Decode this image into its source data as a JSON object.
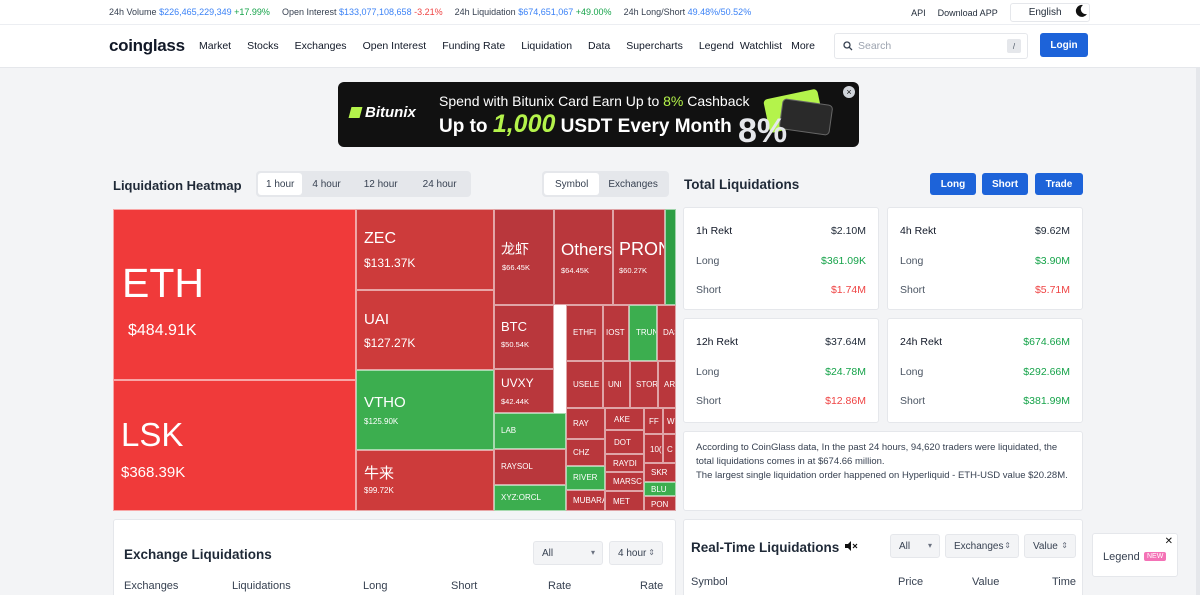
{
  "ticker": {
    "volume_label": "24h Volume",
    "volume_value": "$226,465,229,349",
    "volume_change": "+17.99%",
    "oi_label": "Open Interest",
    "oi_value": "$133,077,108,658",
    "oi_change": "-3.21%",
    "liq_label": "24h Liquidation",
    "liq_value": "$674,651,067",
    "liq_change": "+49.00%",
    "ls_label": "24h Long/Short",
    "ls_value": "49.48%/50.52%",
    "api": "API",
    "download": "Download APP",
    "language": "English"
  },
  "nav": {
    "logo": "coinglass",
    "items": [
      "Market",
      "Stocks",
      "Exchanges",
      "Open Interest",
      "Funding Rate",
      "Liquidation",
      "Data",
      "Supercharts",
      "Legend",
      "Watchlist",
      "More"
    ],
    "search_placeholder": "Search",
    "search_kbd": "/",
    "login": "Login"
  },
  "banner": {
    "brand": "Bitunix",
    "line1_pre": "Spend with Bitunix Card Earn Up to ",
    "line1_hl": "8%",
    "line1_post": " Cashback",
    "line2_pre": "Up to ",
    "line2_hl": "1,000",
    "line2_post": " USDT Every Month"
  },
  "heatmap": {
    "title": "Liquidation Heatmap",
    "time_tabs": [
      "1 hour",
      "4 hour",
      "12 hour",
      "24 hour"
    ],
    "view_tabs": [
      "Symbol",
      "Exchanges"
    ],
    "cells": {
      "eth": {
        "name": "ETH",
        "value": "$484.91K"
      },
      "lsk": {
        "name": "LSK",
        "value": "$368.39K"
      },
      "zec": {
        "name": "ZEC",
        "value": "$131.37K"
      },
      "uai": {
        "name": "UAI",
        "value": "$127.27K"
      },
      "vtho": {
        "name": "VTHO",
        "value": "$125.90K"
      },
      "niulai": {
        "name": "牛来",
        "value": "$99.72K"
      },
      "longxia": {
        "name": "龙虾",
        "value": "$66.45K"
      },
      "others": {
        "name": "Others",
        "value": "$64.45K"
      },
      "pron": {
        "name": "PRON",
        "value": "$60.27K"
      },
      "btc": {
        "name": "BTC",
        "value": "$50.54K"
      },
      "uvxy": {
        "name": "UVXY",
        "value": "$42.44K"
      },
      "lab": {
        "name": "LAB"
      },
      "raysol": {
        "name": "RAYSOL"
      },
      "xyz": {
        "name": "XYZ:ORCL"
      },
      "ethfi": {
        "name": "ETHFI"
      },
      "iost": {
        "name": "IOST"
      },
      "trump": {
        "name": "TRUN"
      },
      "das": {
        "name": "DAS"
      },
      "usele": {
        "name": "USELE"
      },
      "uni": {
        "name": "UNI"
      },
      "stor": {
        "name": "STOR"
      },
      "ar": {
        "name": "AR"
      },
      "ray": {
        "name": "RAY"
      },
      "ake": {
        "name": "AKE"
      },
      "ff": {
        "name": "FF"
      },
      "w": {
        "name": "W"
      },
      "dot": {
        "name": "DOT"
      },
      "chz": {
        "name": "CHZ"
      },
      "ten": {
        "name": "10("
      },
      "c": {
        "name": "C"
      },
      "raydi": {
        "name": "RAYDI"
      },
      "skr": {
        "name": "SKR"
      },
      "river": {
        "name": "RIVER"
      },
      "marsc": {
        "name": "MARSC"
      },
      "blu": {
        "name": "BLU"
      },
      "mubara": {
        "name": "MUBARA"
      },
      "met": {
        "name": "MET"
      },
      "pon": {
        "name": "PON"
      }
    }
  },
  "total": {
    "title": "Total Liquidations",
    "buttons": [
      "Long",
      "Short",
      "Trade"
    ],
    "cards": [
      {
        "label": "1h Rekt",
        "total": "$2.10M",
        "long": "$361.09K",
        "short": "$1.74M"
      },
      {
        "label": "4h Rekt",
        "total": "$9.62M",
        "long": "$3.90M",
        "short": "$5.71M"
      },
      {
        "label": "12h Rekt",
        "total": "$37.64M",
        "long": "$24.78M",
        "short": "$12.86M"
      },
      {
        "label": "24h Rekt",
        "total": "$674.66M",
        "long": "$292.66M",
        "short": "$381.99M"
      }
    ],
    "long_label": "Long",
    "short_label": "Short",
    "info_line1": "According to CoinGlass data, In the past 24 hours, 94,620 traders were liquidated, the total liquidations comes in at $674.66 million.",
    "info_line2": "The largest single liquidation order happened on Hyperliquid - ETH-USD value $20.28M."
  },
  "exchange_liq": {
    "title": "Exchange Liquidations",
    "filter": "All",
    "period": "4 hour",
    "columns": [
      "Exchanges",
      "Liquidations",
      "Long",
      "Short",
      "Rate",
      "Rate"
    ]
  },
  "realtime": {
    "title": "Real-Time Liquidations",
    "filter_all": "All",
    "filter_exchanges": "Exchanges",
    "filter_value": "Value",
    "columns": [
      "Symbol",
      "Price",
      "Value",
      "Time"
    ]
  },
  "legend_widget": {
    "label": "Legend",
    "badge": "NEW"
  },
  "colors": {
    "accent": "#1d63d9",
    "up": "#16a34a",
    "down": "#ef4444",
    "heat_red": "#f03a3a",
    "heat_green": "#3cae4f"
  }
}
